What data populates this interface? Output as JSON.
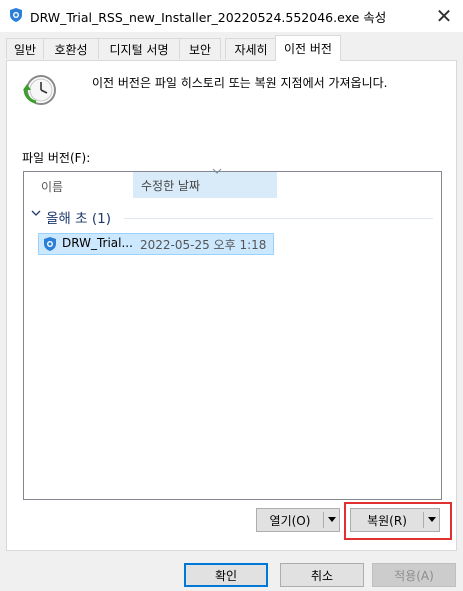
{
  "window": {
    "title": "DRW_Trial_RSS_new_Installer_20220524.552046.exe 속성",
    "close_glyph": "✕"
  },
  "tabs": [
    {
      "label": "일반"
    },
    {
      "label": "호환성"
    },
    {
      "label": "디지털 서명"
    },
    {
      "label": "보안"
    },
    {
      "label": "자세히"
    },
    {
      "label": "이전 버전",
      "active": true
    }
  ],
  "panel": {
    "description": "이전 버전은 파일 히스토리 또는 복원 지점에서 가져옵니다.",
    "icon": "history-restore-icon",
    "file_versions_label": "파일 버전(F):",
    "columns": {
      "name": "이름",
      "date": "수정한 날짜"
    },
    "groups": [
      {
        "label": "올해 초 (1)",
        "items": [
          {
            "name": "DRW_Trial...",
            "date": "2022-05-25 오후 1:18"
          }
        ]
      }
    ],
    "buttons": {
      "open": "열기(O)",
      "restore": "복원(R)"
    }
  },
  "footer": {
    "ok": "확인",
    "cancel": "취소",
    "apply": "적용(A)"
  },
  "colors": {
    "accent": "#0078d7",
    "selection": "#cce8ff",
    "group_text": "#1e3a6e",
    "highlight_box": "#e03030"
  }
}
